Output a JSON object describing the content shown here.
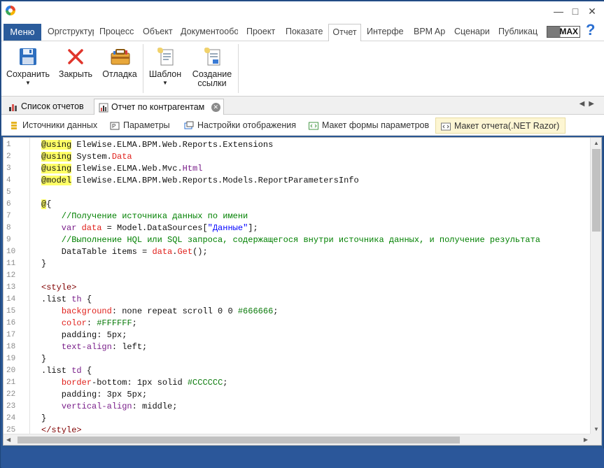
{
  "menubar": {
    "menu_label": "Меню",
    "tabs": [
      "Оргструктура",
      "Процесс",
      "Объект",
      "Документообо",
      "Проект",
      "Показате",
      "Отчет",
      "Интерфе",
      "BPM Ap",
      "Сценари",
      "Публикац"
    ],
    "max_label": "MAX",
    "help_label": "?"
  },
  "ribbon": {
    "save": "Сохранить",
    "close": "Закрыть",
    "debug": "Отладка",
    "template": "Шаблон",
    "create_link_1": "Создание",
    "create_link_2": "ссылки"
  },
  "doc_tabs": [
    "Список отчетов",
    "Отчет по контрагентам"
  ],
  "sub_tabs": [
    "Источники данных",
    "Параметры",
    "Настройки отображения",
    "Макет формы параметров",
    "Макет отчета(.NET Razor)"
  ],
  "colors": {
    "accent": "#2b579a",
    "directive_bg": "#ffff66",
    "keyword": "#0000ff",
    "comment": "#008000",
    "type": "#a31515",
    "tag": "#800000",
    "css_prop": "#ff0000"
  },
  "editor": {
    "lines": [
      [
        {
          "t": "@using",
          "c": "dir"
        },
        {
          "t": " EleWise.ELMA.BPM.Web.Reports.Extensions",
          "c": "plain"
        }
      ],
      [
        {
          "t": "@using",
          "c": "dir"
        },
        {
          "t": " System.",
          "c": "plain"
        },
        {
          "t": "Data",
          "c": "red"
        }
      ],
      [
        {
          "t": "@using",
          "c": "dir"
        },
        {
          "t": " EleWise.ELMA.Web.Mvc.",
          "c": "plain"
        },
        {
          "t": "Html",
          "c": "purple"
        }
      ],
      [
        {
          "t": "@model",
          "c": "dir"
        },
        {
          "t": " EleWise.ELMA.BPM.Web.Reports.Models.ReportParametersInfo",
          "c": "plain"
        }
      ],
      [],
      [
        {
          "t": "@",
          "c": "dir"
        },
        {
          "t": "{",
          "c": "plain"
        }
      ],
      [
        {
          "t": "    //Получение источника данных по имени",
          "c": "comment"
        }
      ],
      [
        {
          "t": "    var ",
          "c": "purple"
        },
        {
          "t": "data",
          "c": "red"
        },
        {
          "t": " = Model.DataSources[",
          "c": "plain"
        },
        {
          "t": "\"Данные\"",
          "c": "blue"
        },
        {
          "t": "];",
          "c": "plain"
        }
      ],
      [
        {
          "t": "    //Выполнение HQL или SQL запроса, содержащегося внутри источника данных, и получение результата",
          "c": "comment"
        }
      ],
      [
        {
          "t": "    DataTable items = ",
          "c": "plain"
        },
        {
          "t": "data",
          "c": "red"
        },
        {
          "t": ".",
          "c": "plain"
        },
        {
          "t": "Get",
          "c": "red"
        },
        {
          "t": "();",
          "c": "plain"
        }
      ],
      [
        {
          "t": "}",
          "c": "plain"
        }
      ],
      [],
      [
        {
          "t": "<style>",
          "c": "tag"
        }
      ],
      [
        {
          "t": ".list ",
          "c": "plain"
        },
        {
          "t": "th",
          "c": "purple"
        },
        {
          "t": " {",
          "c": "plain"
        }
      ],
      [
        {
          "t": "    ",
          "c": "plain"
        },
        {
          "t": "background",
          "c": "red"
        },
        {
          "t": ": none repeat scroll 0 0 ",
          "c": "plain"
        },
        {
          "t": "#666666",
          "c": "green"
        },
        {
          "t": ";",
          "c": "plain"
        }
      ],
      [
        {
          "t": "    ",
          "c": "plain"
        },
        {
          "t": "color",
          "c": "red"
        },
        {
          "t": ": ",
          "c": "plain"
        },
        {
          "t": "#FFFFFF",
          "c": "green"
        },
        {
          "t": ";",
          "c": "plain"
        }
      ],
      [
        {
          "t": "    padding: 5px;",
          "c": "plain"
        }
      ],
      [
        {
          "t": "    ",
          "c": "plain"
        },
        {
          "t": "text-align",
          "c": "purple"
        },
        {
          "t": ": left;",
          "c": "plain"
        }
      ],
      [
        {
          "t": "}",
          "c": "plain"
        }
      ],
      [
        {
          "t": ".list ",
          "c": "plain"
        },
        {
          "t": "td",
          "c": "purple"
        },
        {
          "t": " {",
          "c": "plain"
        }
      ],
      [
        {
          "t": "    ",
          "c": "plain"
        },
        {
          "t": "border",
          "c": "red"
        },
        {
          "t": "-bottom: 1px solid ",
          "c": "plain"
        },
        {
          "t": "#CCCCCC",
          "c": "green"
        },
        {
          "t": ";",
          "c": "plain"
        }
      ],
      [
        {
          "t": "    padding: 3px 5px;",
          "c": "plain"
        }
      ],
      [
        {
          "t": "    ",
          "c": "plain"
        },
        {
          "t": "vertical-align",
          "c": "purple"
        },
        {
          "t": ": middle;",
          "c": "plain"
        }
      ],
      [
        {
          "t": "}",
          "c": "plain"
        }
      ],
      [
        {
          "t": "</style>",
          "c": "tag"
        }
      ]
    ]
  }
}
